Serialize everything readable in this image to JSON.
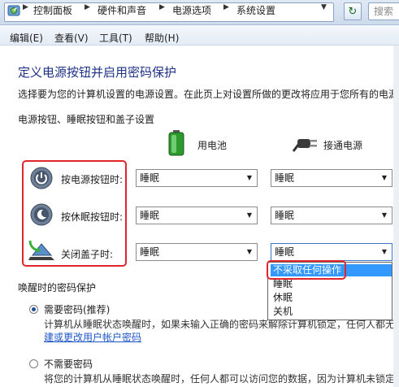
{
  "address_bar": {
    "crumbs": [
      "控制面板",
      "硬件和声音",
      "电源选项",
      "系统设置"
    ],
    "search_placeholder": "搜索"
  },
  "menu": [
    "编辑(E)",
    "查看(V)",
    "工具(T)",
    "帮助(H)"
  ],
  "page": {
    "title": "定义电源按钮并启用密码保护",
    "description": "选择要为您的计算机设置的电源设置。在此页上对设置所做的更改将应用于您所有的电源计",
    "section_title": "电源按钮、睡眠按钮和盖子设置"
  },
  "columns": {
    "battery": "用电池",
    "plugged": "接通电源"
  },
  "rows": [
    {
      "label": "按电源按钮时:",
      "battery": "睡眠",
      "plugged": "睡眠"
    },
    {
      "label": "按休眠按钮时:",
      "battery": "睡眠",
      "plugged": "睡眠"
    },
    {
      "label": "关闭盖子时:",
      "battery": "睡眠",
      "plugged": "睡眠"
    }
  ],
  "dropdown_options": [
    "不采取任何操作",
    "睡眠",
    "休眠",
    "关机"
  ],
  "wake": {
    "title": "唤醒时的密码保护",
    "require_label": "需要密码(推荐)",
    "require_desc": "计算机从睡眠状态唤醒时，如果未输入正确的密码来解除计算机锁定，任何人都无",
    "require_link": "建或更改用户帐户密码",
    "norequire_label": "不需要密码",
    "norequire_desc": "将您的计算机从睡眠状态唤醒时，任何人都可以访问您的数据，因为计算机未锁定。"
  },
  "colors": {
    "title": "#1e3287",
    "link": "#1e57c8",
    "highlight": "#3399ff",
    "annotation": "#e0262d"
  }
}
